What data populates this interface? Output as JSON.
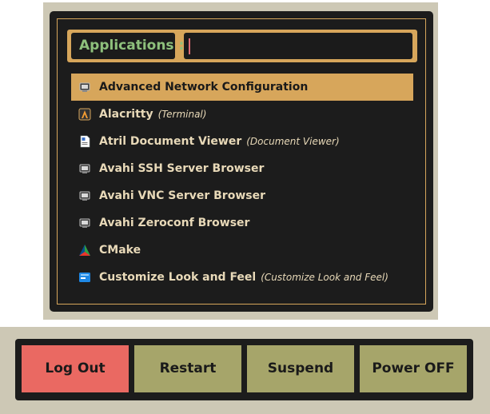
{
  "launcher": {
    "prompt_label": "Applications :",
    "entry_value": "",
    "items": [
      {
        "name": "Advanced Network Configuration",
        "generic": "",
        "icon": "network-icon",
        "selected": true
      },
      {
        "name": "Alacritty",
        "generic": "(Terminal)",
        "icon": "alacritty-icon",
        "selected": false
      },
      {
        "name": "Atril Document Viewer",
        "generic": "(Document Viewer)",
        "icon": "document-viewer-icon",
        "selected": false
      },
      {
        "name": "Avahi SSH Server Browser",
        "generic": "",
        "icon": "network-icon",
        "selected": false
      },
      {
        "name": "Avahi VNC Server Browser",
        "generic": "",
        "icon": "network-icon",
        "selected": false
      },
      {
        "name": "Avahi Zeroconf Browser",
        "generic": "",
        "icon": "network-icon",
        "selected": false
      },
      {
        "name": "CMake",
        "generic": "",
        "icon": "cmake-icon",
        "selected": false
      },
      {
        "name": "Customize Look and Feel",
        "generic": "(Customize Look and Feel)",
        "icon": "appearance-icon",
        "selected": false
      }
    ]
  },
  "power": {
    "buttons": [
      {
        "label": "Log Out",
        "active": true
      },
      {
        "label": "Restart",
        "active": false
      },
      {
        "label": "Suspend",
        "active": false
      },
      {
        "label": "Power OFF",
        "active": false
      }
    ]
  },
  "colors": {
    "accent": "#d7a65b",
    "prompt_text": "#8ec07c",
    "background": "#1c1c1c",
    "outer_frame": "#cdc8b5",
    "active_button": "#ea6962",
    "button": "#a6a56a"
  }
}
